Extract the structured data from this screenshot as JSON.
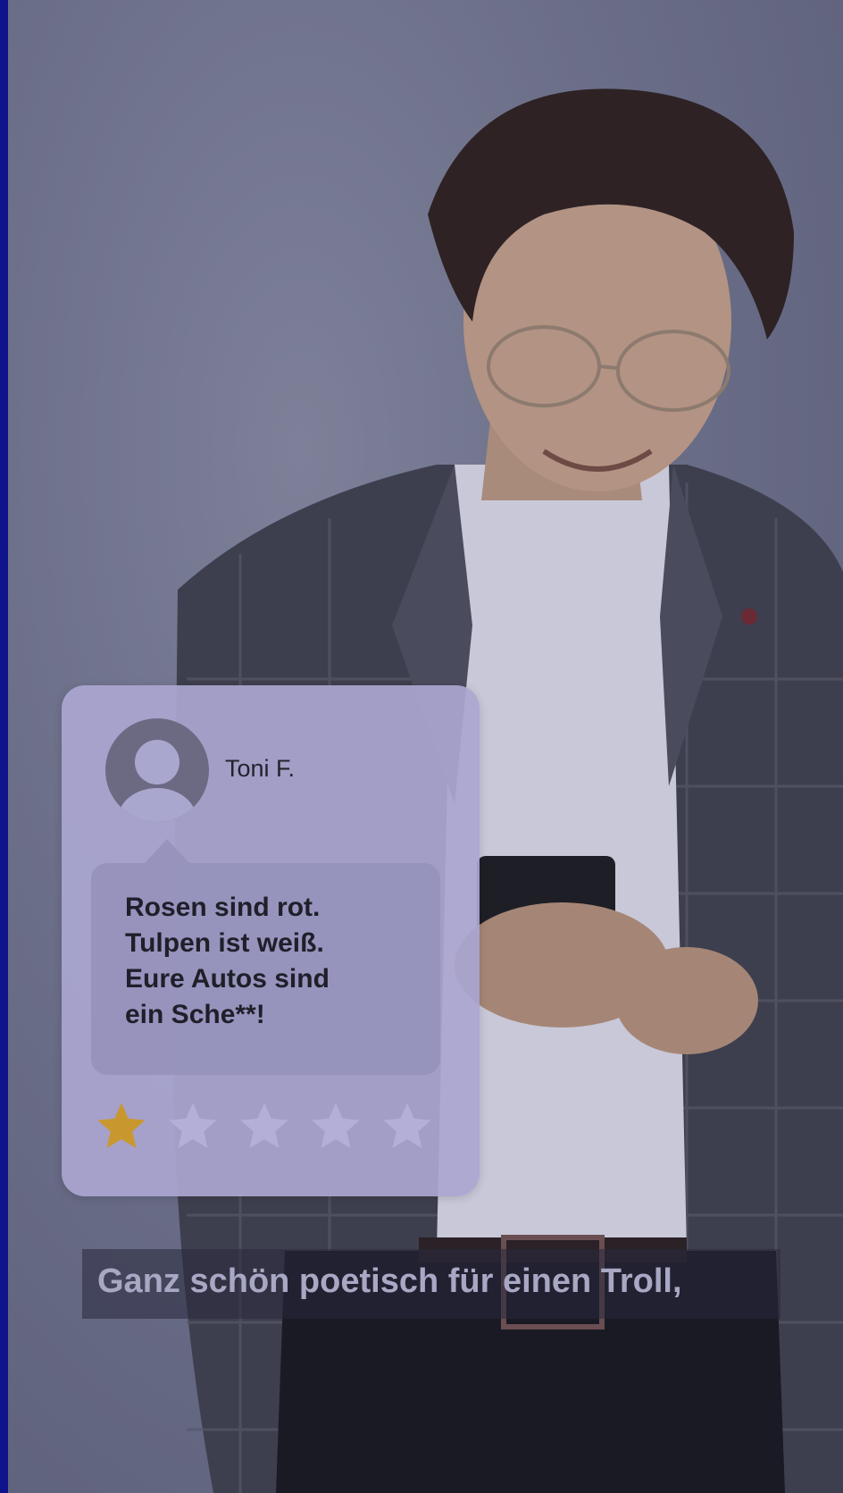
{
  "review": {
    "name": "Toni F.",
    "text_lines": [
      "Rosen sind rot.",
      "Tulpen ist weiß.",
      "Eure Autos sind",
      "ein Sche**!"
    ],
    "rating": 1,
    "max_rating": 5,
    "star_filled_color": "#c8982e",
    "star_empty_color": "#b3afd6"
  },
  "subtitle": {
    "text": "Ganz schön poetisch für einen Troll,"
  },
  "icons": {
    "avatar": "user-avatar-icon",
    "star": "star-icon"
  }
}
